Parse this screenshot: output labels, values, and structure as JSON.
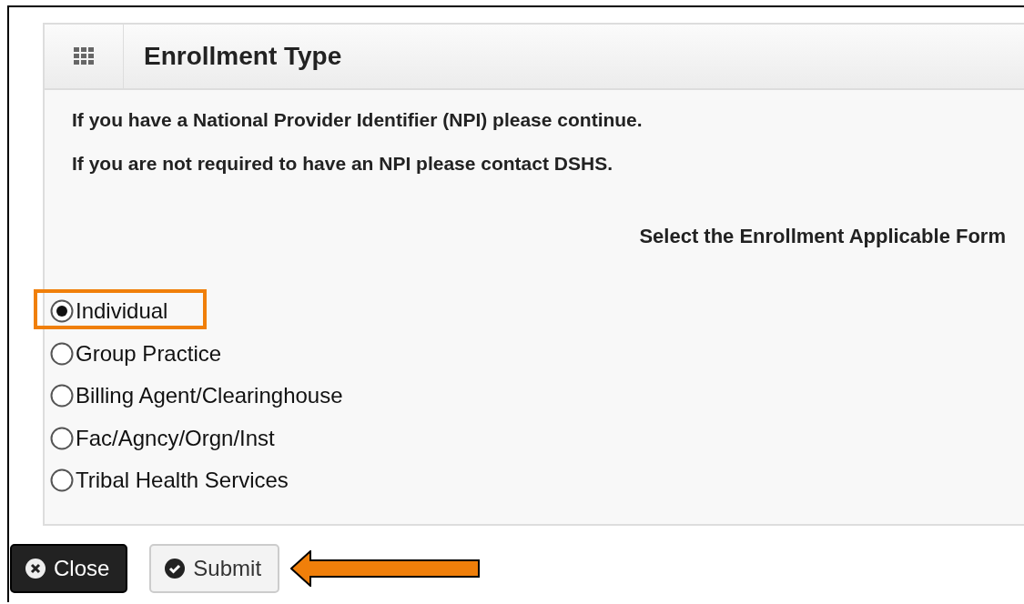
{
  "panel": {
    "title": "Enrollment Type",
    "messages": [
      "If you have a National Provider Identifier (NPI) please continue.",
      "If you are not required to have an NPI please contact DSHS."
    ],
    "prompt": "Select the Enrollment Applicable Form",
    "options": [
      {
        "label": "Individual",
        "selected": true,
        "highlighted": true
      },
      {
        "label": "Group Practice",
        "selected": false,
        "highlighted": false
      },
      {
        "label": "Billing Agent/Clearinghouse",
        "selected": false,
        "highlighted": false
      },
      {
        "label": "Fac/Agncy/Orgn/Inst",
        "selected": false,
        "highlighted": false
      },
      {
        "label": "Tribal Health Services",
        "selected": false,
        "highlighted": false
      }
    ]
  },
  "buttons": [
    {
      "label": "Close",
      "kind": "dark",
      "pointed": false
    },
    {
      "label": "Submit",
      "kind": "light",
      "pointed": true
    }
  ]
}
